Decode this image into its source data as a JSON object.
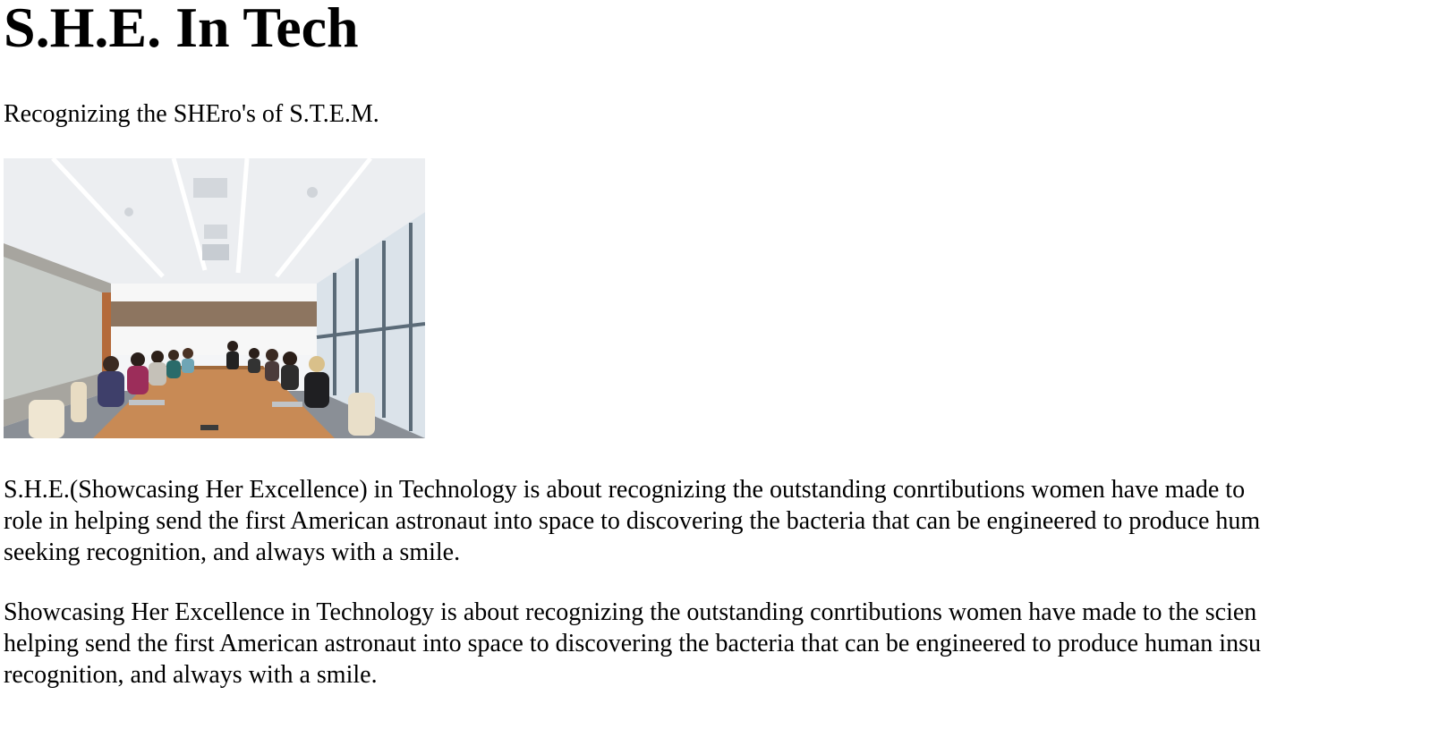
{
  "page": {
    "title": "S.H.E. In Tech",
    "subtitle": "Recognizing the SHEro's of S.T.E.M.",
    "hero_image_icon": "conference-room-photo",
    "paragraph1": {
      "line1": "S.H.E.(Showcasing Her Excellence) in Technology is about recognizing the outstanding conrtibutions women have made to",
      "line2": "role in helping send the first American astronaut into space to discovering the bacteria that can be engineered to produce hum",
      "line3": "seeking recognition, and always with a smile."
    },
    "paragraph2": {
      "line1": "Showcasing Her Excellence in Technology is about recognizing the outstanding conrtibutions women have made to the scien",
      "line2": "helping send the first American astronaut into space to discovering the bacteria that can be engineered to produce human insu",
      "line3": "recognition, and always with a smile."
    }
  }
}
